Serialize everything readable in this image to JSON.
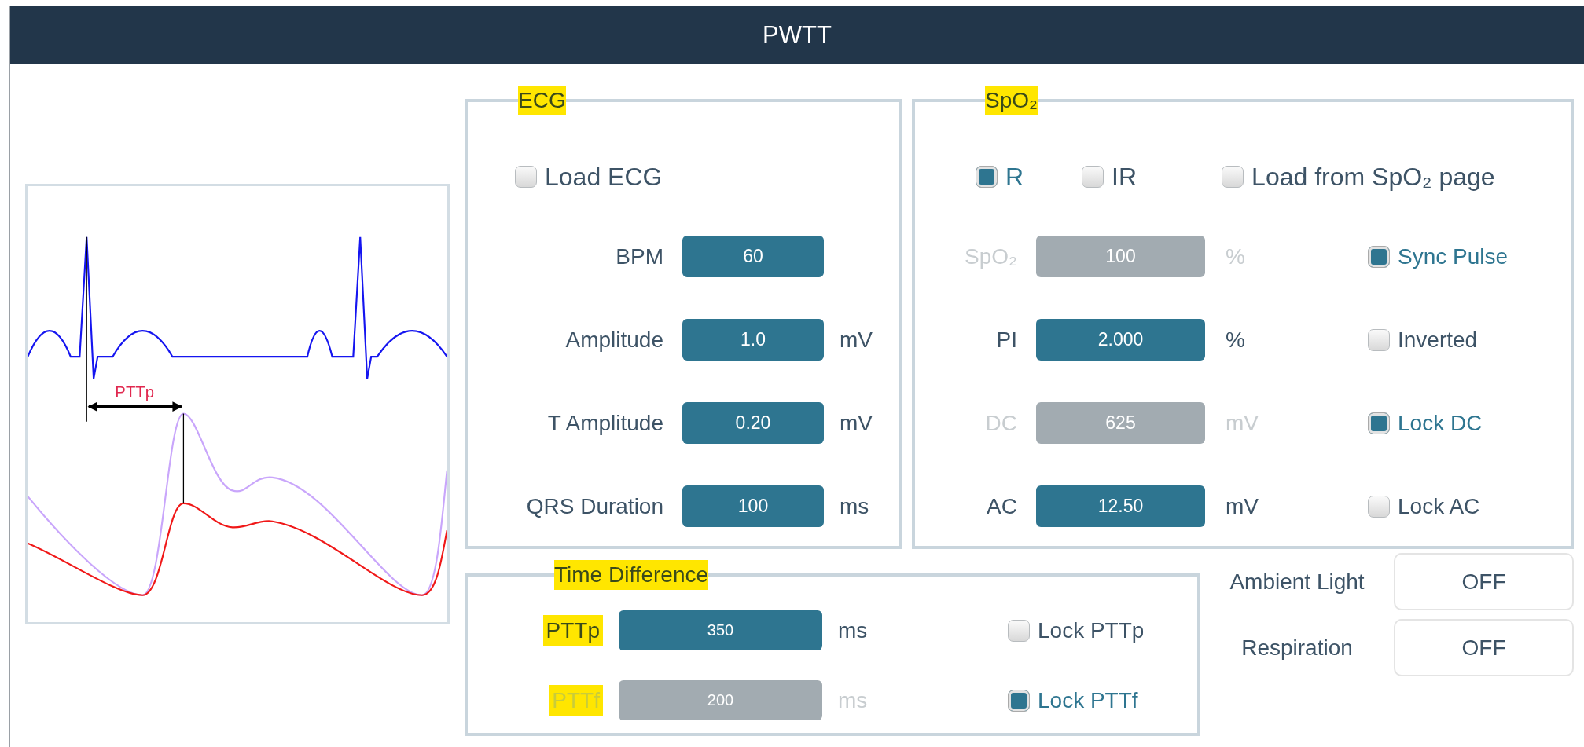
{
  "window": {
    "title": "PWTT"
  },
  "graph": {
    "label": "PTTp"
  },
  "ecg": {
    "title": "ECG",
    "highlighted": true,
    "load": {
      "label": "Load ECG",
      "checked": false
    },
    "params": [
      {
        "label": "BPM",
        "value": "60",
        "disabled": false
      },
      {
        "label": "Amplitude",
        "value": "1.0",
        "unit": "mV",
        "disabled": false
      },
      {
        "label": "T Amplitude",
        "value": "0.20",
        "unit": "mV",
        "disabled": false
      },
      {
        "label": "QRS Duration",
        "value": "100",
        "unit": "ms",
        "disabled": false
      }
    ]
  },
  "spo2": {
    "title": "SpO₂",
    "highlighted": true,
    "sources": [
      {
        "label": "R",
        "checked": true
      },
      {
        "label": "IR",
        "checked": false
      }
    ],
    "load": {
      "label": "Load from SpO₂ page",
      "checked": false
    },
    "params": [
      {
        "label": "SpO₂",
        "value": "100",
        "unit": "%",
        "disabled": true,
        "option": {
          "label": "Sync Pulse",
          "checked": true
        }
      },
      {
        "label": "PI",
        "value": "2.000",
        "unit": "%",
        "disabled": false,
        "option": {
          "label": "Inverted",
          "checked": false
        }
      },
      {
        "label": "DC",
        "value": "625",
        "unit": "mV",
        "disabled": true,
        "option": {
          "label": "Lock DC",
          "checked": true
        }
      },
      {
        "label": "AC",
        "value": "12.50",
        "unit": "mV",
        "disabled": false,
        "option": {
          "label": "Lock AC",
          "checked": false
        }
      }
    ]
  },
  "time_difference": {
    "title": "Time Difference",
    "highlighted": true,
    "params": [
      {
        "label": "PTTp",
        "value": "350",
        "unit": "ms",
        "disabled": false,
        "highlighted": true,
        "option": {
          "label": "Lock PTTp",
          "checked": false
        }
      },
      {
        "label": "PTTf",
        "value": "200",
        "unit": "ms",
        "disabled": true,
        "highlighted": true,
        "option": {
          "label": "Lock PTTf",
          "checked": true
        }
      }
    ]
  },
  "toggles": [
    {
      "label": "Ambient Light",
      "value": "OFF"
    },
    {
      "label": "Respiration",
      "value": "OFF"
    }
  ]
}
